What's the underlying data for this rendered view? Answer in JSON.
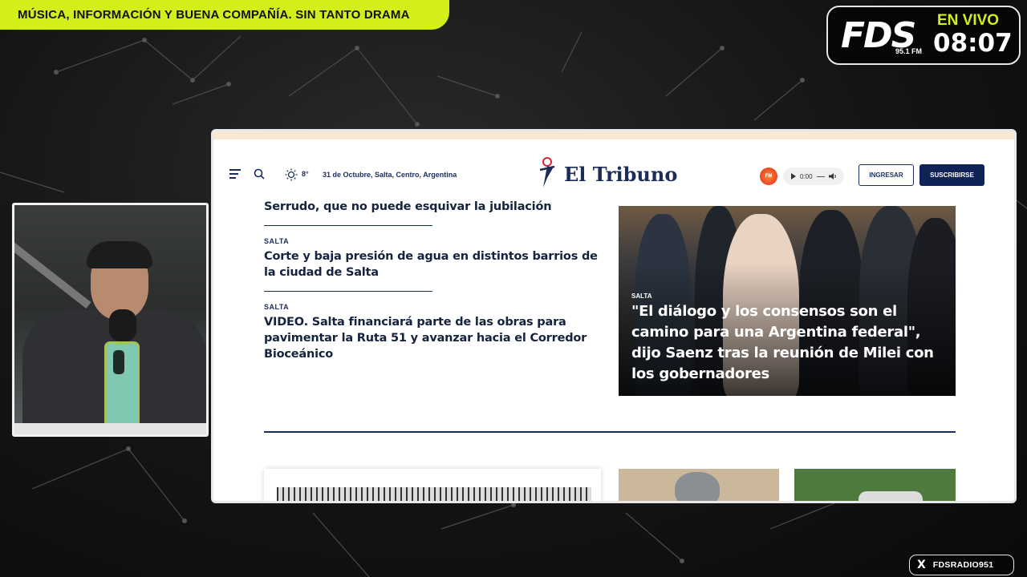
{
  "banner": {
    "text": "MÚSICA, INFORMACIÓN Y BUENA COMPAÑÍA. SIN TANTO DRAMA"
  },
  "logo": {
    "brand": "FDS",
    "frequency": "95.1 FM",
    "live_label": "EN VIVO",
    "time": "08:07"
  },
  "site": {
    "temperature": "8°",
    "date_location": "31 de Octubre, Salta, Centro, Argentina",
    "brand_name": "El Tribuno",
    "player_time": "0:00",
    "login_label": "INGRESAR",
    "subscribe_label": "SUSCRIBIRSE",
    "articles": [
      {
        "category": "",
        "title": "Serrudo, que no puede esquivar la jubilación"
      },
      {
        "category": "SALTA",
        "title": "Corte y baja presión de agua en distintos barrios de la ciudad de Salta"
      },
      {
        "category": "SALTA",
        "title": "VIDEO. Salta financiará parte de las obras para pavimentar la Ruta 51 y avanzar hacia el Corredor Bioceánico"
      }
    ],
    "feature": {
      "category": "SALTA",
      "title": "\"El diálogo y los consensos son el camino para una Argentina federal\", dijo Saenz tras la reunión de Milei con los gobernadores"
    }
  },
  "social": {
    "network_icon": "x-icon",
    "handle": "FDSRADIO951"
  },
  "colors": {
    "accent": "#d4ee1c",
    "navy": "#1c2d5a",
    "subscribe_bg": "#0f2357"
  }
}
